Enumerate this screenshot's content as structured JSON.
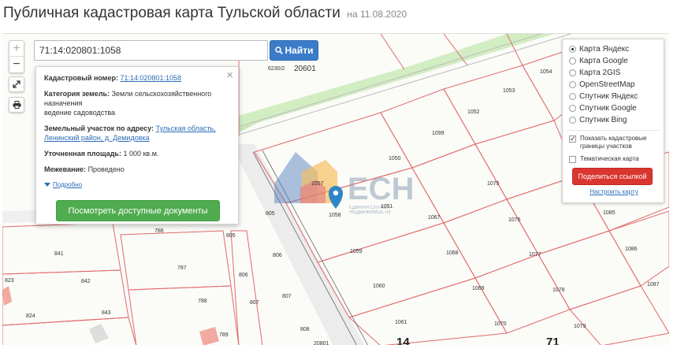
{
  "header": {
    "title": "Публичная кадастровая карта Тульской области",
    "date": "на 11.08.2020"
  },
  "search": {
    "value": "71:14:020801:1058",
    "button_label": "Найти"
  },
  "zoom": {
    "plus": "+",
    "minus": "−"
  },
  "popup": {
    "cadastral_label": "Кадастровый номер:",
    "cadastral_value": "71:14:020801:1058",
    "category_label": "Категория земель:",
    "category_value": "Земли сельскохозяйственного назначения",
    "category_use": "ведение садоводства",
    "address_label": "Земельный участок по адресу:",
    "address_value": "Тульская область, Ленинский район, д. Демидовка",
    "area_label": "Уточненная площадь:",
    "area_value": "1 000 кв.м.",
    "survey_label": "Межевание:",
    "survey_value": "Проведено",
    "more_label": "Подробно",
    "docs_button": "Посмотреть доступные документы",
    "close": "×"
  },
  "layers": {
    "options": [
      {
        "label": "Карта Яндекс",
        "selected": true
      },
      {
        "label": "Карта Google",
        "selected": false
      },
      {
        "label": "Карта 2GIS",
        "selected": false
      },
      {
        "label": "OpenStreetMap",
        "selected": false
      },
      {
        "label": "Спутник Яндекс",
        "selected": false
      },
      {
        "label": "Спутник Google",
        "selected": false
      },
      {
        "label": "Спутник Bing",
        "selected": false
      }
    ],
    "show_borders_label": "Показать кадастровые границы участков",
    "show_borders_checked": true,
    "thematic_label": "Тематическая карта",
    "thematic_checked": false,
    "share_button": "Поделиться ссылкой",
    "config_link": "Настроить карту"
  },
  "watermark": {
    "brand": "ЕСН",
    "line1": "ЕДИНАЯ СЛУЖБА",
    "line2": "НЕДВИЖИМОСТИ"
  },
  "map_labels": {
    "quarter_code": "6230/2",
    "zone": "20601",
    "zone_bottom": "20801",
    "big_14": "14",
    "big_71": "71",
    "parcels": [
      "1054",
      "1053",
      "1052",
      "1099",
      "1050",
      "1051",
      "1057",
      "1058",
      "1075",
      "1067",
      "1076",
      "1085",
      "1086",
      "1087",
      "1059",
      "1068",
      "1077",
      "1060",
      "1069",
      "1078",
      "1061",
      "1070",
      "1079",
      "786",
      "805",
      "806",
      "787",
      "806",
      "807",
      "788",
      "807",
      "808",
      "789",
      "841",
      "842",
      "843",
      "823",
      "824",
      "805"
    ]
  },
  "colors": {
    "green_area": "#c6e8b2",
    "parcel_border": "#e06a6a",
    "road": "#d4d4d4",
    "search_btn": "#3b7cc9",
    "docs_btn": "#4fac4f",
    "share_btn": "#d9362f",
    "marker": "#2f86c7"
  }
}
